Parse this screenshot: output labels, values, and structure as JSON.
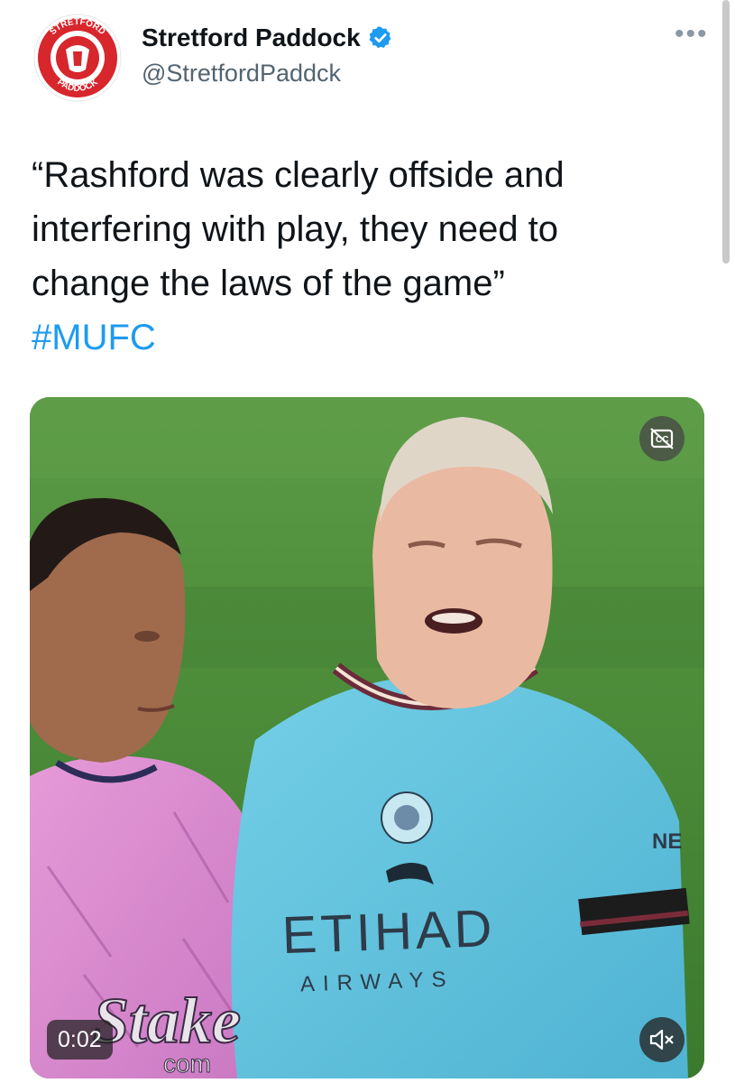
{
  "author": {
    "display_name": "Stretford Paddock",
    "handle": "@StretfordPaddck",
    "verified": true,
    "avatar_text_top": "STRETFORD",
    "avatar_text_bottom": "PADDOCK",
    "avatar_color": "#d7262c"
  },
  "more_menu": {
    "icon": "more-horizontal-icon"
  },
  "tweet": {
    "text": "“Rashford was clearly offside and interfering with play, they need to change the laws of the game”",
    "hashtag": "#MUFC"
  },
  "video": {
    "elapsed": "0:02",
    "cc_icon": "closed-captions-off-icon",
    "mute_icon": "volume-muted-icon",
    "kit_sponsor_left": "Stake",
    "kit_sponsor_left_sub": "com",
    "kit_sponsor_right": "ETIHAD",
    "kit_sponsor_right_sub": "AIRWAYS",
    "sleeve_text": "NE"
  },
  "colors": {
    "link": "#1d9bf0",
    "verified_badge": "#1d9bf0",
    "text_primary": "#0f1419",
    "text_secondary": "#536471"
  }
}
